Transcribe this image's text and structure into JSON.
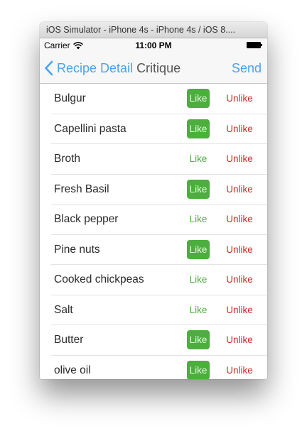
{
  "window": {
    "title": "iOS Simulator - iPhone 4s - iPhone 4s / iOS 8...."
  },
  "status_bar": {
    "carrier": "Carrier",
    "time": "11:00 PM",
    "icons": [
      "wifi-icon",
      "battery-icon"
    ]
  },
  "nav": {
    "back_label": "Recipe Detail",
    "title": "Critique",
    "send_label": "Send",
    "accent_color": "#4aa3f0"
  },
  "colors": {
    "like_green": "#4caf3d",
    "unlike_red": "#cc2b2b"
  },
  "ingredients": [
    {
      "name": "Bulgur",
      "like_label": "Like",
      "unlike_label": "Unlike",
      "liked": true
    },
    {
      "name": "Capellini pasta",
      "like_label": "Like",
      "unlike_label": "Unlike",
      "liked": true
    },
    {
      "name": "Broth",
      "like_label": "Like",
      "unlike_label": "Unlike",
      "liked": false
    },
    {
      "name": "Fresh Basil",
      "like_label": "Like",
      "unlike_label": "Unlike",
      "liked": true
    },
    {
      "name": "Black pepper",
      "like_label": "Like",
      "unlike_label": "Unlike",
      "liked": false
    },
    {
      "name": "Pine nuts",
      "like_label": "Like",
      "unlike_label": "Unlike",
      "liked": true
    },
    {
      "name": "Cooked chickpeas",
      "like_label": "Like",
      "unlike_label": "Unlike",
      "liked": false
    },
    {
      "name": "Salt",
      "like_label": "Like",
      "unlike_label": "Unlike",
      "liked": false
    },
    {
      "name": "Butter",
      "like_label": "Like",
      "unlike_label": "Unlike",
      "liked": true
    },
    {
      "name": "olive oil",
      "like_label": "Like",
      "unlike_label": "Unlike",
      "liked": true
    }
  ]
}
